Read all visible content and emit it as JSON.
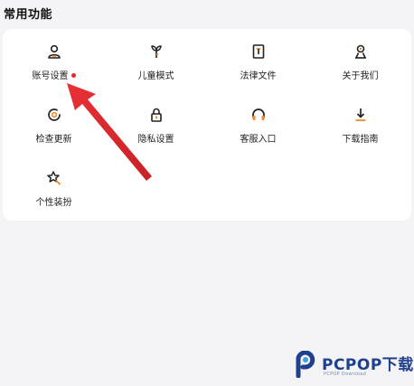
{
  "section": {
    "title": "常用功能"
  },
  "grid": {
    "items": [
      {
        "label": "账号设置",
        "icon": "user-icon",
        "has_badge": true
      },
      {
        "label": "儿童模式",
        "icon": "sprout-icon",
        "has_badge": false
      },
      {
        "label": "法律文件",
        "icon": "document-icon",
        "has_badge": false
      },
      {
        "label": "关于我们",
        "icon": "about-us-icon",
        "has_badge": false
      },
      {
        "label": "检查更新",
        "icon": "update-icon",
        "has_badge": false
      },
      {
        "label": "隐私设置",
        "icon": "lock-icon",
        "has_badge": false
      },
      {
        "label": "客服入口",
        "icon": "headset-icon",
        "has_badge": false
      },
      {
        "label": "下载指南",
        "icon": "download-icon",
        "has_badge": false
      },
      {
        "label": "个性装扮",
        "icon": "star-brush-icon",
        "has_badge": false
      }
    ]
  },
  "colors": {
    "accent": "#e8262b",
    "icon_orange": "#f08a24",
    "icon_dark": "#222222",
    "background": "#f4f4f6",
    "card": "#ffffff",
    "watermark_blue": "#1f3f8f"
  },
  "watermark": {
    "brand": "PCPOP下载",
    "subtitle": "PCPOP Download"
  }
}
